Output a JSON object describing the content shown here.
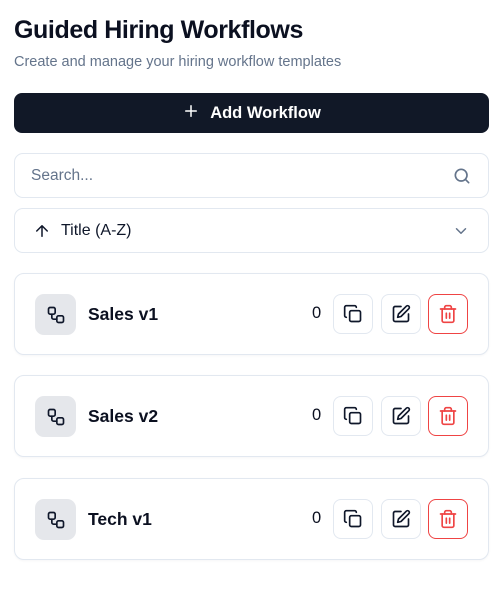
{
  "header": {
    "title": "Guided Hiring Workflows",
    "subtitle": "Create and manage your hiring workflow templates"
  },
  "toolbar": {
    "add_label": "Add Workflow",
    "add_icon": "plus-icon"
  },
  "search": {
    "placeholder": "Search...",
    "value": "",
    "icon": "search-icon"
  },
  "sort": {
    "selected": "Title (A-Z)",
    "direction_icon": "arrow-up-icon",
    "dropdown_icon": "chevron-down-icon"
  },
  "workflows": [
    {
      "name": "Sales v1",
      "count": "0"
    },
    {
      "name": "Sales v2",
      "count": "0"
    },
    {
      "name": "Tech v1",
      "count": "0"
    }
  ],
  "colors": {
    "primary": "#111827",
    "muted_text": "#64748b",
    "border": "#e2e8f0",
    "danger": "#ef4444",
    "icon_bg": "#e5e7eb"
  }
}
